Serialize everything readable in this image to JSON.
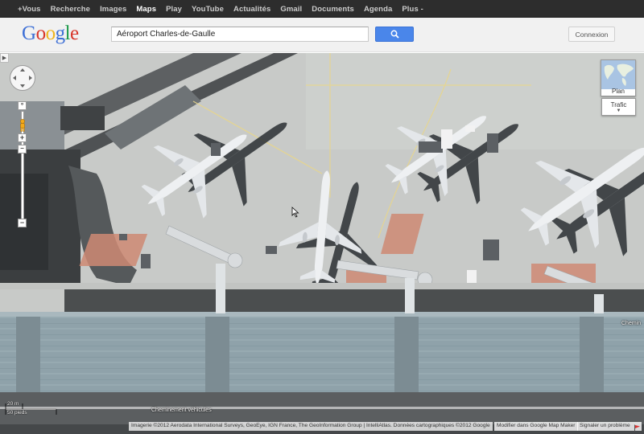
{
  "topbar": {
    "items": [
      {
        "label": "+Vous"
      },
      {
        "label": "Recherche"
      },
      {
        "label": "Images"
      },
      {
        "label": "Maps"
      },
      {
        "label": "Play"
      },
      {
        "label": "YouTube"
      },
      {
        "label": "Actualités"
      },
      {
        "label": "Gmail"
      },
      {
        "label": "Documents"
      },
      {
        "label": "Agenda"
      },
      {
        "label": "Plus -"
      }
    ],
    "active_item": "Maps"
  },
  "header": {
    "logo": {
      "letters": [
        "G",
        "o",
        "o",
        "g",
        "l",
        "e"
      ]
    },
    "search": {
      "value": "Aéroport Charles-de-Gaulle"
    },
    "search_button_icon": "magnifier-icon",
    "signin_label": "Connexion"
  },
  "map": {
    "map_type": {
      "plan_label": "Plan",
      "traffic_label": "Trafic"
    },
    "scale": {
      "metric": "20 m",
      "imperial": "50 pieds"
    },
    "street_labels": {
      "bottom": "Cheminement véhicules",
      "right": "Chemin"
    },
    "attribution": "Imagerie ©2012 Aerodata International Surveys, GeoEye, IGN France, The GeoInformation Group | IntelliAtlas. Données cartographiques ©2012 Google",
    "links": {
      "edit": "Modifier dans Google Map Maker",
      "report": "Signaler un problème"
    }
  },
  "colors": {
    "topbar_bg": "#2d2d2d",
    "search_button": "#4a86ea",
    "apron": "#c9cbc9",
    "terminal_roof": "#8ea3ab"
  }
}
